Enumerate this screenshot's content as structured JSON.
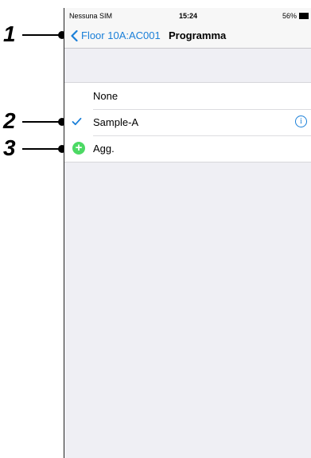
{
  "status_bar": {
    "carrier": "Nessuna SIM",
    "time": "15:24",
    "battery": "56%"
  },
  "nav": {
    "back_label": "Floor 10A:AC001",
    "title": "Programma"
  },
  "list": {
    "items": [
      {
        "label": "None",
        "checked": false
      },
      {
        "label": "Sample-A",
        "checked": true
      },
      {
        "label": "Agg."
      }
    ]
  },
  "info_glyph": "i",
  "add_glyph": "+",
  "callouts": [
    "1",
    "2",
    "3"
  ],
  "colors": {
    "accent": "#1a7fd8",
    "add_green": "#4cd964",
    "background": "#efeff4"
  }
}
